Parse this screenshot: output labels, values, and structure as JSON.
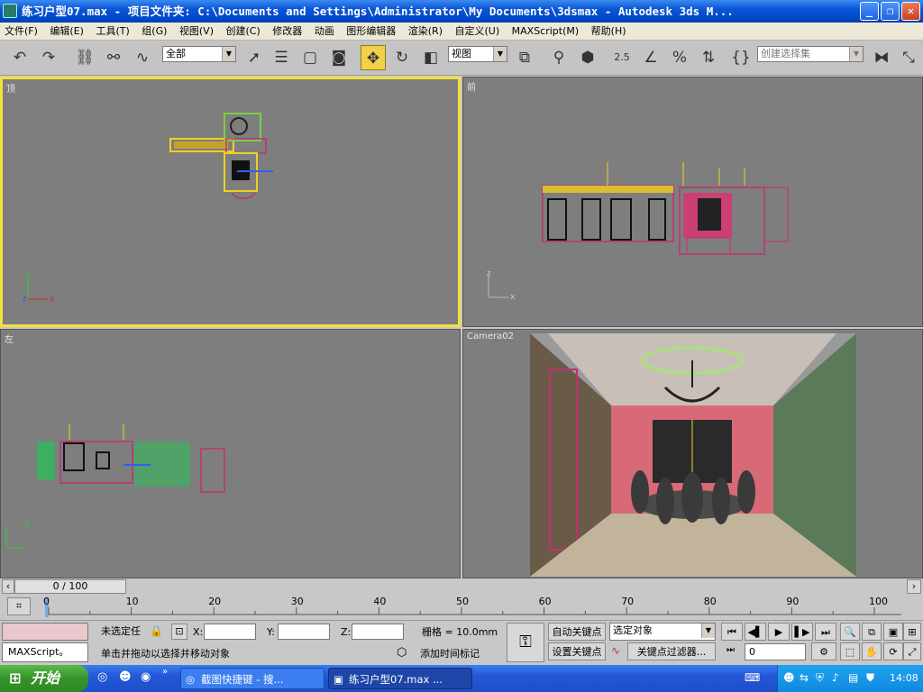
{
  "window": {
    "title": "练习户型07.max    - 项目文件夹: C:\\Documents and Settings\\Administrator\\My Documents\\3dsmax    - Autodesk 3ds M...",
    "min": "_",
    "restore": "❐",
    "close": "✕"
  },
  "menu": [
    "文件(F)",
    "编辑(E)",
    "工具(T)",
    "组(G)",
    "视图(V)",
    "创建(C)",
    "修改器",
    "动画",
    "图形编辑器",
    "渲染(R)",
    "自定义(U)",
    "MAXScript(M)",
    "帮助(H)"
  ],
  "toolbar": {
    "filter_value": "全部",
    "refcoord_value": "视图",
    "snap_label": "2.5",
    "selection_set_placeholder": "创建选择集"
  },
  "viewports": {
    "top": "顶",
    "front": "前",
    "left": "左",
    "camera": "Camera02"
  },
  "axes": {
    "x": "x",
    "y": "y",
    "z": "z"
  },
  "timeline": {
    "frame_display": "0 / 100",
    "ticks": [
      "0",
      "10",
      "20",
      "30",
      "40",
      "50",
      "60",
      "70",
      "80",
      "90",
      "100"
    ]
  },
  "status": {
    "maxscript": "MAXScript。",
    "selection": "未选定任",
    "x_label": "X:",
    "y_label": "Y:",
    "z_label": "Z:",
    "grid": "栅格 = 10.0mm",
    "prompt": "单击并拖动以选择并移动对象",
    "add_time_tag": "添加时间标记",
    "auto_key": "自动关键点",
    "set_key": "设置关键点",
    "key_mode_value": "选定对象",
    "key_filters": "关键点过滤器...",
    "current_frame": "0"
  },
  "taskbar": {
    "start": "开始",
    "tasks": [
      "截图快捷键 - 搜...",
      "练习户型07.max  ..."
    ],
    "time": "14:08"
  },
  "colors": {
    "xp_blue": "#2457d8",
    "viewport_bg": "#7e7e7e",
    "active_border": "#f2e23a",
    "auto_key_red": "#e0b8b8"
  }
}
